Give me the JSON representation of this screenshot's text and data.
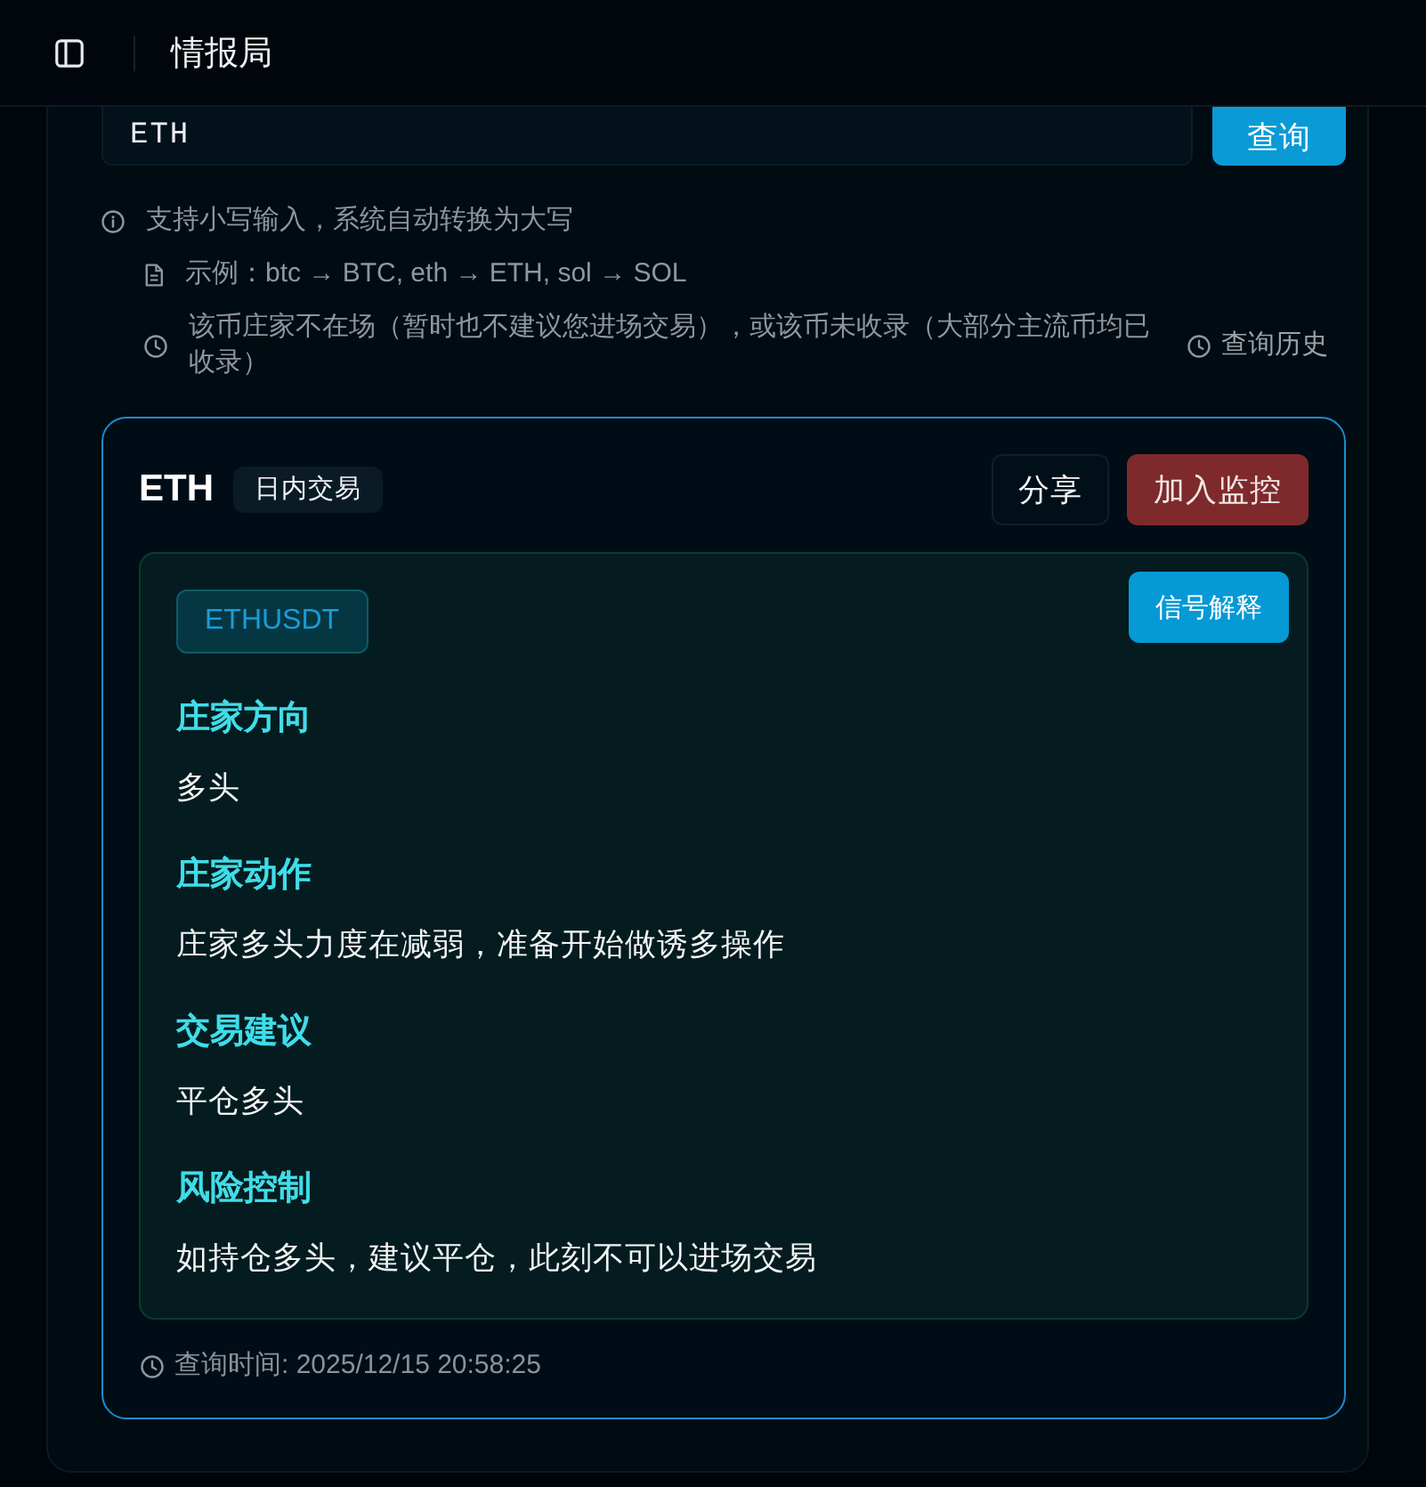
{
  "header": {
    "title": "情报局"
  },
  "search": {
    "value": "ETH",
    "button": "查询"
  },
  "hints": [
    {
      "kind": "info",
      "text": "支持小写输入，系统自动转换为大写"
    },
    {
      "kind": "example",
      "text": "示例：btc → BTC, eth → ETH, sol → SOL"
    },
    {
      "kind": "note",
      "text": "该币庄家不在场（暂时也不建议您进场交易），或该币未收录（大部分主流币均已收录）"
    }
  ],
  "history_link": "查询历史",
  "result": {
    "symbol": "ETH",
    "mode_badge": "日内交易",
    "buttons": [
      {
        "label": "分享",
        "kind": "secondary"
      },
      {
        "label": "加入监控",
        "kind": "danger"
      }
    ],
    "pair": "ETHUSDT",
    "explain_button": "信号解释",
    "sections": [
      {
        "title": "庄家方向",
        "text": "多头"
      },
      {
        "title": "庄家动作",
        "text": "庄家多头力度在减弱，准备开始做诱多操作"
      },
      {
        "title": "交易建议",
        "text": "平仓多头"
      },
      {
        "title": "风险控制",
        "text": "如持仓多头，建议平仓，此刻不可以进场交易"
      }
    ],
    "query_time": "查询时间: 2025/12/15 20:58:25"
  }
}
